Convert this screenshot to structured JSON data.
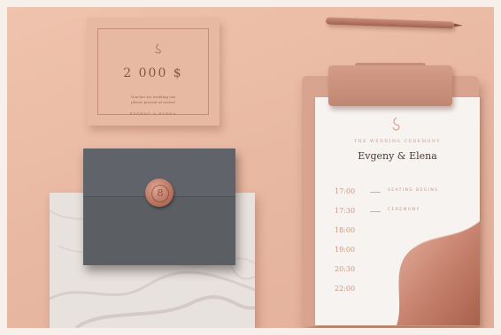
{
  "gift_card": {
    "amount": "2 000 $",
    "line1": "Voucher for wedding use",
    "line2": "please present at arrival",
    "line3": "EVGENY & ELENA"
  },
  "invitation": {
    "heading": "THE WEDDING CEREMONY",
    "names": "Evgeny & Elena",
    "schedule": [
      {
        "time": "17:00",
        "event": "SEATING BEGINS"
      },
      {
        "time": "17:30",
        "event": "CEREMONY"
      },
      {
        "time": "18:00",
        "event": ""
      },
      {
        "time": "19:00",
        "event": ""
      },
      {
        "time": "20:30",
        "event": ""
      },
      {
        "time": "22:00",
        "event": ""
      }
    ]
  },
  "seal": {
    "monogram": "8"
  },
  "colors": {
    "background": "#e9b9a3",
    "envelope": "#5b5e63",
    "accent": "#c99584",
    "copper": "#b8735e"
  }
}
